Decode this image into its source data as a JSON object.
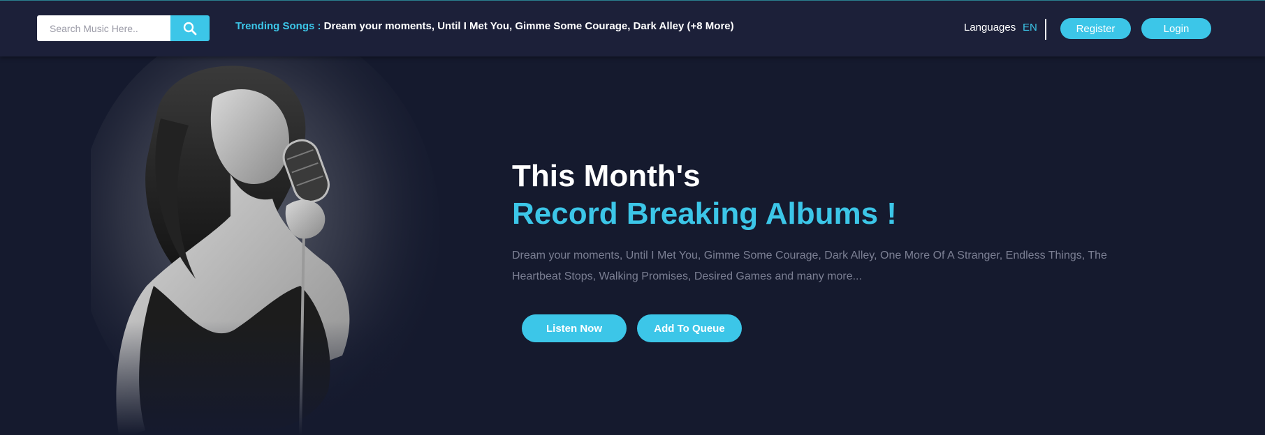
{
  "header": {
    "search": {
      "placeholder": "Search Music Here..",
      "value": ""
    },
    "search_icon": "search-icon",
    "trending_label": "Trending Songs :",
    "trending_songs": " Dream your moments, Until I Met You, Gimme Some Courage, Dark Alley (+8 More)",
    "languages_label": "Languages",
    "language_code": "EN",
    "register_label": "Register",
    "login_label": "Login"
  },
  "hero": {
    "title_line1": "This Month's",
    "title_line2": "Record Breaking Albums !",
    "description": "Dream your moments, Until I Met You, Gimme Some Courage, Dark Alley, One More Of A Stranger, Endless Things, The Heartbeat Stops, Walking Promises, Desired Games and many more...",
    "listen_label": "Listen Now",
    "queue_label": "Add To Queue"
  },
  "colors": {
    "accent": "#3cc6e8",
    "background": "#151a2e",
    "topbar": "#1c2039",
    "muted_text": "#7b7f93"
  }
}
